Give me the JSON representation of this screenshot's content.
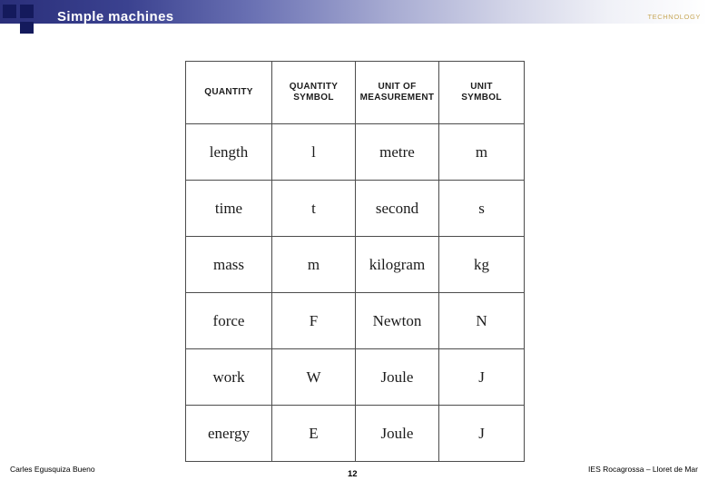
{
  "header": {
    "title": "Simple machines",
    "right_label": "TECHNOLOGY",
    "accent_color": "#141a5c",
    "right_label_color": "#c8a85a"
  },
  "table": {
    "columns": [
      "QUANTITY",
      "QUANTITY SYMBOL",
      "UNIT OF MEASUREMENT",
      "UNIT SYMBOL"
    ],
    "columns_lines": [
      [
        "QUANTITY"
      ],
      [
        "QUANTITY",
        "SYMBOL"
      ],
      [
        "UNIT OF",
        "MEASUREMENT"
      ],
      [
        "UNIT",
        "SYMBOL"
      ]
    ],
    "rows": [
      {
        "quantity": "length",
        "quantity_symbol": "l",
        "unit": "metre",
        "unit_symbol": "m"
      },
      {
        "quantity": "time",
        "quantity_symbol": "t",
        "unit": "second",
        "unit_symbol": "s"
      },
      {
        "quantity": "mass",
        "quantity_symbol": "m",
        "unit": "kilogram",
        "unit_symbol": "kg"
      },
      {
        "quantity": "force",
        "quantity_symbol": "F",
        "unit": "Newton",
        "unit_symbol": "N"
      },
      {
        "quantity": "work",
        "quantity_symbol": "W",
        "unit": "Joule",
        "unit_symbol": "J"
      },
      {
        "quantity": "energy",
        "quantity_symbol": "E",
        "unit": "Joule",
        "unit_symbol": "J"
      }
    ]
  },
  "footer": {
    "author": "Carles Egusquiza Bueno",
    "page_number": "12",
    "school": "IES Rocagrossa – Lloret de Mar"
  }
}
